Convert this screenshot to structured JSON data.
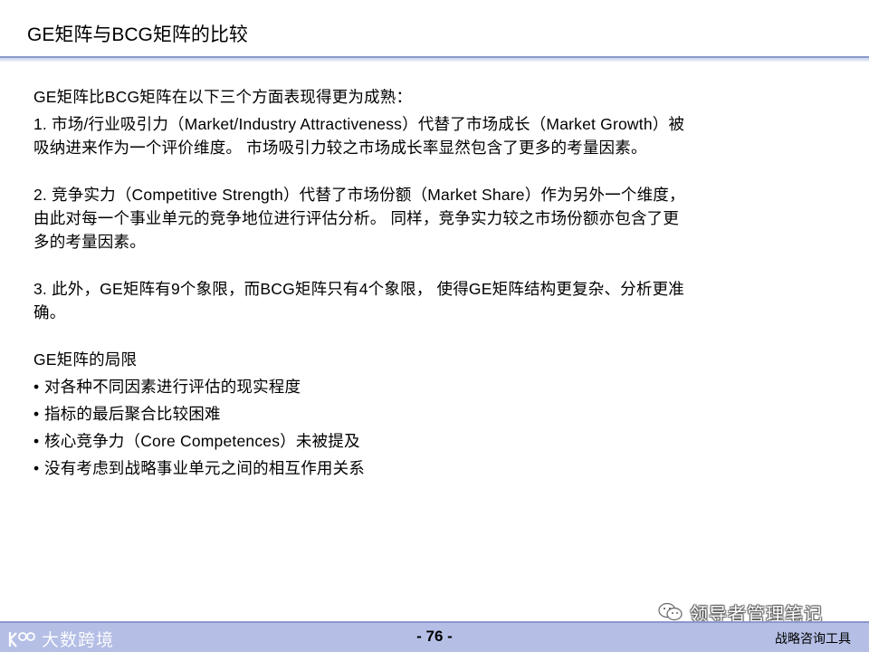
{
  "slide": {
    "title": "GE矩阵与BCG矩阵的比较"
  },
  "content": {
    "intro": "GE矩阵比BCG矩阵在以下三个方面表现得更为成熟：",
    "point1_line1": "1. 市场/行业吸引力（Market/Industry  Attractiveness）代替了市场成长（Market  Growth）被",
    "point1_line2": "吸纳进来作为一个评价维度。  市场吸引力较之市场成长率显然包含了更多的考量因素。",
    "point2_line1": "2. 竞争实力（Competitive  Strength）代替了市场份额（Market  Share）作为另外一个维度，",
    "point2_line2": "由此对每一个事业单元的竞争地位进行评估分析。  同样，竞争实力较之市场份额亦包含了更",
    "point2_line3": "多的考量因素。",
    "point3_line1": "3. 此外，GE矩阵有9个象限，而BCG矩阵只有4个象限，   使得GE矩阵结构更复杂、分析更准",
    "point3_line2": "确。",
    "limits_heading": "GE矩阵的局限",
    "limits": [
      "对各种不同因素进行评估的现实程度",
      "指标的最后聚合比较困难",
      "核心竞争力（Core  Competences）未被提及",
      "没有考虑到战略事业单元之间的相互作用关系"
    ],
    "bullet_char": "•"
  },
  "watermark": {
    "text": "领导者管理笔记",
    "icon": "wechat-icon"
  },
  "footer": {
    "logo_text": "大数跨境",
    "logo_icon": "k100-logo-icon",
    "page_number": "- 76 -",
    "tag": "战略咨询工具",
    "bar_color": "#b5bfe6"
  }
}
